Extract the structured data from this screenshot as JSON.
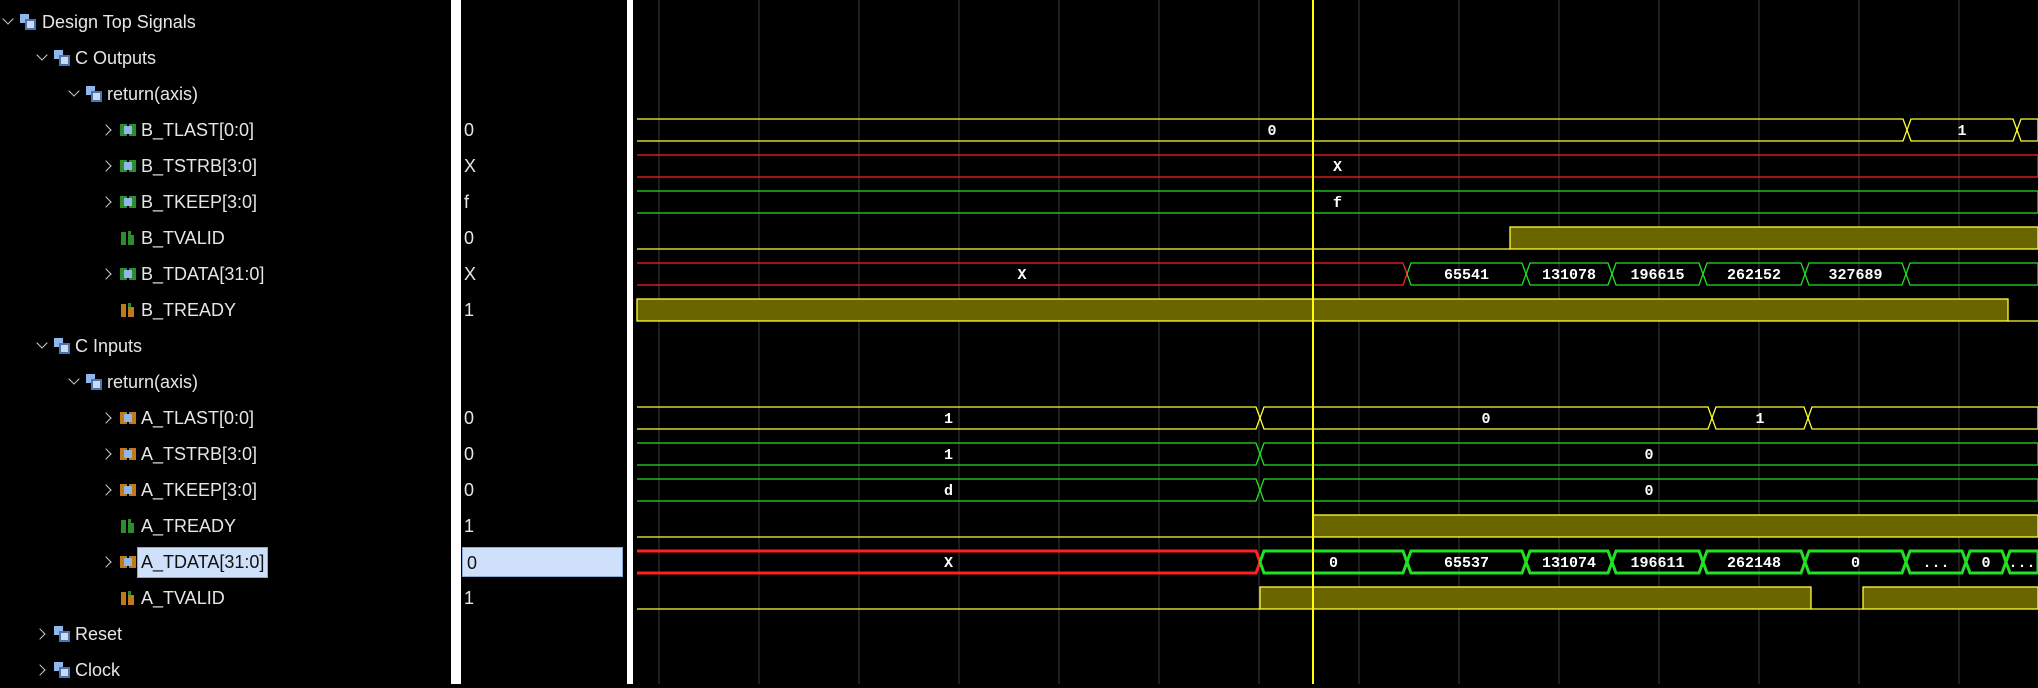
{
  "tree": [
    {
      "id": "design-top",
      "label": "Design Top Signals",
      "depth": 0,
      "expander": "down",
      "icon": "scope-icon",
      "value": ""
    },
    {
      "id": "c-outputs",
      "label": "C Outputs",
      "depth": 1,
      "expander": "down",
      "icon": "scope-icon",
      "value": ""
    },
    {
      "id": "out-return-axis",
      "label": "return(axis)",
      "depth": 2,
      "expander": "down",
      "icon": "scope-icon",
      "value": ""
    },
    {
      "id": "b-tlast",
      "label": "B_TLAST[0:0]",
      "depth": 3,
      "expander": "right",
      "icon": "bus-out-icon",
      "value": "0"
    },
    {
      "id": "b-tstrb",
      "label": "B_TSTRB[3:0]",
      "depth": 3,
      "expander": "right",
      "icon": "bus-out-icon",
      "value": "X"
    },
    {
      "id": "b-tkeep",
      "label": "B_TKEEP[3:0]",
      "depth": 3,
      "expander": "right",
      "icon": "bus-out-icon",
      "value": "f"
    },
    {
      "id": "b-tvalid",
      "label": "B_TVALID",
      "depth": 3,
      "expander": "none",
      "icon": "bit-out-icon",
      "value": "0"
    },
    {
      "id": "b-tdata",
      "label": "B_TDATA[31:0]",
      "depth": 3,
      "expander": "right",
      "icon": "bus-out-icon",
      "value": "X"
    },
    {
      "id": "b-tready",
      "label": "B_TREADY",
      "depth": 3,
      "expander": "none",
      "icon": "bit-in-icon",
      "value": "1"
    },
    {
      "id": "c-inputs",
      "label": "C Inputs",
      "depth": 1,
      "expander": "down",
      "icon": "scope-icon",
      "value": ""
    },
    {
      "id": "in-return-axis",
      "label": "return(axis)",
      "depth": 2,
      "expander": "down",
      "icon": "scope-icon",
      "value": ""
    },
    {
      "id": "a-tlast",
      "label": "A_TLAST[0:0]",
      "depth": 3,
      "expander": "right",
      "icon": "bus-in-icon",
      "value": "0"
    },
    {
      "id": "a-tstrb",
      "label": "A_TSTRB[3:0]",
      "depth": 3,
      "expander": "right",
      "icon": "bus-in-icon",
      "value": "0"
    },
    {
      "id": "a-tkeep",
      "label": "A_TKEEP[3:0]",
      "depth": 3,
      "expander": "right",
      "icon": "bus-in-icon",
      "value": "0"
    },
    {
      "id": "a-tready",
      "label": "A_TREADY",
      "depth": 3,
      "expander": "none",
      "icon": "bit-out-icon",
      "value": "1"
    },
    {
      "id": "a-tdata",
      "label": "A_TDATA[31:0]",
      "depth": 3,
      "expander": "right",
      "icon": "bus-in-icon",
      "value": "0",
      "selected": true
    },
    {
      "id": "a-tvalid",
      "label": "A_TVALID",
      "depth": 3,
      "expander": "none",
      "icon": "bit-in-icon",
      "value": "1"
    },
    {
      "id": "reset",
      "label": "Reset",
      "depth": 1,
      "expander": "right",
      "icon": "scope-icon",
      "value": ""
    },
    {
      "id": "clock",
      "label": "Clock",
      "depth": 1,
      "expander": "right",
      "icon": "scope-icon",
      "value": ""
    }
  ],
  "waves": [
    {
      "row": 3,
      "kind": "bus",
      "segments": [
        {
          "label": "0",
          "color": "yellow"
        },
        {
          "label": "1",
          "color": "yellow"
        },
        {
          "label": "",
          "color": "yellow"
        }
      ]
    },
    {
      "row": 4,
      "kind": "bus",
      "segments": [
        {
          "label": "X",
          "color": "red"
        }
      ]
    },
    {
      "row": 5,
      "kind": "bus",
      "segments": [
        {
          "label": "f",
          "color": "green"
        }
      ]
    },
    {
      "row": 6,
      "kind": "bit",
      "levels": [
        0,
        1
      ]
    },
    {
      "row": 7,
      "kind": "bus",
      "segments": [
        {
          "label": "X",
          "color": "red"
        },
        {
          "label": "65541",
          "color": "green"
        },
        {
          "label": "131078",
          "color": "green"
        },
        {
          "label": "196615",
          "color": "green"
        },
        {
          "label": "262152",
          "color": "green"
        },
        {
          "label": "327689",
          "color": "green"
        },
        {
          "label": "",
          "color": "green"
        }
      ]
    },
    {
      "row": 8,
      "kind": "bit",
      "levels": [
        1,
        0
      ]
    },
    {
      "row": 11,
      "kind": "bus",
      "segments": [
        {
          "label": "1",
          "color": "yellow"
        },
        {
          "label": "0",
          "color": "yellow"
        },
        {
          "label": "1",
          "color": "yellow"
        },
        {
          "label": "",
          "color": "yellow"
        }
      ]
    },
    {
      "row": 12,
      "kind": "bus",
      "segments": [
        {
          "label": "1",
          "color": "green"
        },
        {
          "label": "0",
          "color": "green"
        }
      ]
    },
    {
      "row": 13,
      "kind": "bus",
      "segments": [
        {
          "label": "d",
          "color": "green"
        },
        {
          "label": "0",
          "color": "green"
        }
      ]
    },
    {
      "row": 14,
      "kind": "bit",
      "levels": [
        0,
        1
      ]
    },
    {
      "row": 15,
      "kind": "bus",
      "bold": true,
      "segments": [
        {
          "label": "X",
          "color": "red"
        },
        {
          "label": "0",
          "color": "green"
        },
        {
          "label": "65537",
          "color": "green"
        },
        {
          "label": "131074",
          "color": "green"
        },
        {
          "label": "196611",
          "color": "green"
        },
        {
          "label": "262148",
          "color": "green"
        },
        {
          "label": "0",
          "color": "green"
        },
        {
          "label": "...",
          "color": "green"
        },
        {
          "label": "0",
          "color": "green"
        },
        {
          "label": "...",
          "color": "green"
        }
      ]
    },
    {
      "row": 16,
      "kind": "bit",
      "levels": [
        0,
        1,
        0,
        1
      ]
    }
  ],
  "colors": {
    "yellow": "#ffff33",
    "green": "#22e022",
    "red": "#ff2020",
    "cursor": "#ffff00",
    "grid": "#3a3a3a",
    "fill": "#6b6500",
    "selection": "#cfe0fb"
  }
}
